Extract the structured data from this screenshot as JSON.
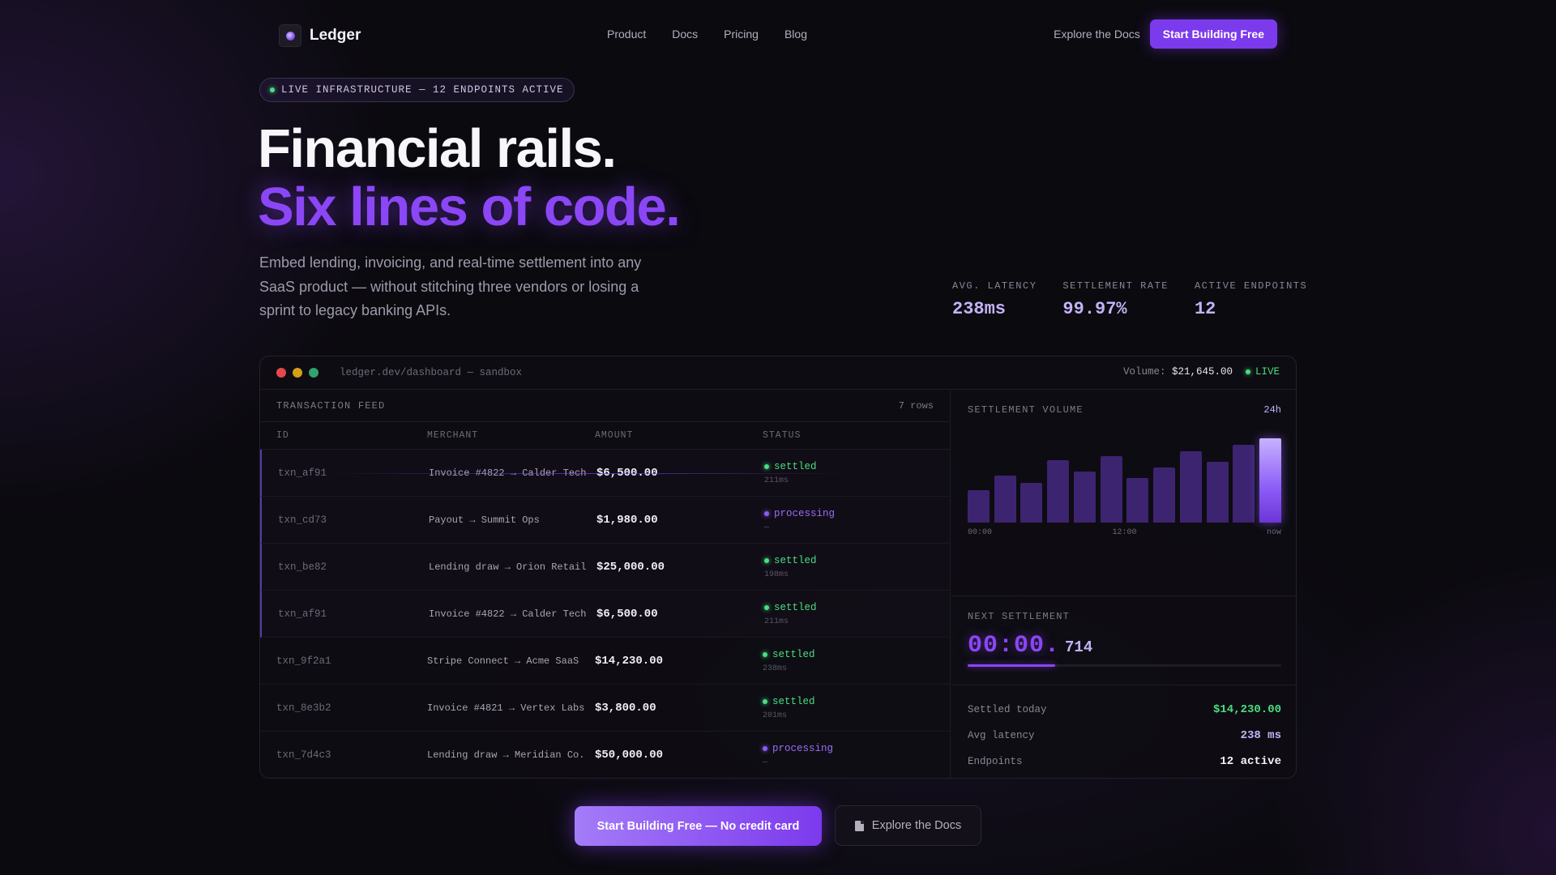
{
  "nav": {
    "brand": "Ledger",
    "links": [
      "Product",
      "Docs",
      "Pricing",
      "Blog"
    ],
    "docs_link": "Explore the Docs",
    "cta": "Start Building Free"
  },
  "hero": {
    "badge": "LIVE INFRASTRUCTURE — 12 ENDPOINTS ACTIVE",
    "title_line1": "Financial rails.",
    "title_line2": "Six lines of code.",
    "lead": "Embed lending, invoicing, and real-time settlement into any SaaS product — without stitching three vendors or losing a sprint to legacy banking APIs."
  },
  "stats": [
    {
      "label": "AVG. LATENCY",
      "value": "238ms"
    },
    {
      "label": "SETTLEMENT RATE",
      "value": "99.97%"
    },
    {
      "label": "ACTIVE ENDPOINTS",
      "value": "12"
    }
  ],
  "dashboard": {
    "url": "ledger.dev/dashboard — sandbox",
    "volume_label": "Volume:",
    "volume_value": "$21,645.00",
    "live": "LIVE",
    "feed_title": "TRANSACTION FEED",
    "rows_count": "7 rows",
    "columns": [
      "ID",
      "MERCHANT",
      "AMOUNT",
      "STATUS"
    ],
    "rows": [
      {
        "id": "txn_af91",
        "merchant": "Invoice #4822 → Calder Tech",
        "amount": "$6,500.00",
        "status": "settled",
        "sub": "211ms"
      },
      {
        "id": "txn_cd73",
        "merchant": "Payout → Summit Ops",
        "amount": "$1,980.00",
        "status": "processing",
        "sub": "—"
      },
      {
        "id": "txn_be82",
        "merchant": "Lending draw → Orion Retail",
        "amount": "$25,000.00",
        "status": "settled",
        "sub": "198ms"
      },
      {
        "id": "txn_af91",
        "merchant": "Invoice #4822 → Calder Tech",
        "amount": "$6,500.00",
        "status": "settled",
        "sub": "211ms"
      },
      {
        "id": "txn_9f2a1",
        "merchant": "Stripe Connect → Acme SaaS",
        "amount": "$14,230.00",
        "status": "settled",
        "sub": "238ms"
      },
      {
        "id": "txn_8e3b2",
        "merchant": "Invoice #4821 → Vertex Labs",
        "amount": "$3,800.00",
        "status": "settled",
        "sub": "201ms"
      },
      {
        "id": "txn_7d4c3",
        "merchant": "Lending draw → Meridian Co.",
        "amount": "$50,000.00",
        "status": "processing",
        "sub": "—"
      }
    ],
    "volume_chart": {
      "title": "SETTLEMENT VOLUME",
      "period": "24h",
      "axis": [
        "00:00",
        "12:00",
        "now"
      ],
      "bar_levels": [
        0.38,
        0.56,
        0.47,
        0.74,
        0.61,
        0.79,
        0.53,
        0.65,
        0.85,
        0.72,
        0.92,
        1.0
      ]
    },
    "next_settlement": {
      "title": "NEXT SETTLEMENT",
      "time": "00:00.",
      "ms": "714",
      "progress": 0.28
    },
    "summary": [
      {
        "key": "Settled today",
        "value": "$14,230.00",
        "color": "#4ade80"
      },
      {
        "key": "Avg latency",
        "value": "238 ms",
        "color": "#c4b2f7"
      },
      {
        "key": "Endpoints",
        "value": "12 active",
        "color": "#f4f2f8"
      }
    ]
  },
  "cta": {
    "primary": "Start Building Free — No credit card",
    "secondary": "Explore the Docs"
  },
  "colors": {
    "accent": "#7c3aed",
    "settled": "#4ade80",
    "processing": "#9d6cf8"
  }
}
